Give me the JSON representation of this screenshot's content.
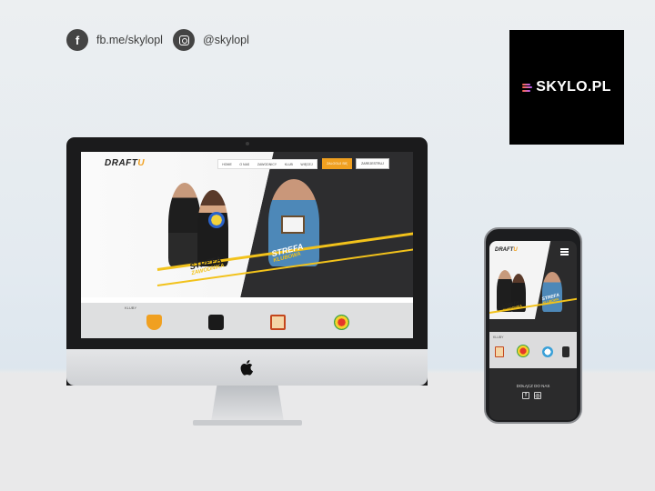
{
  "social": {
    "facebook": "fb.me/skylopl",
    "instagram": "@skylopl"
  },
  "brand": {
    "logo_text": "SKYLO.PL"
  },
  "site": {
    "logo_prefix": "DRAFT",
    "logo_suffix": "U",
    "nav": [
      "HOME",
      "O NAS",
      "ZAWODNICY",
      "KLUB",
      "WIĘCEJ"
    ],
    "login_label": "ZALOGUJ SIĘ",
    "register_label": "ZAREJESTRUJ",
    "zone_left_title": "STREFA",
    "zone_left_sub": "ZAWODNIKA",
    "zone_right_title": "STREFA",
    "zone_right_sub": "KLUBOWA",
    "clubs_title": "KLUBY"
  },
  "mobile": {
    "clubs_title": "KLUBY",
    "join_label": "DOŁĄCZ DO NAS"
  },
  "colors": {
    "accent": "#f0a020",
    "stripe": "#f2c21b",
    "dark": "#2d2d2f"
  }
}
